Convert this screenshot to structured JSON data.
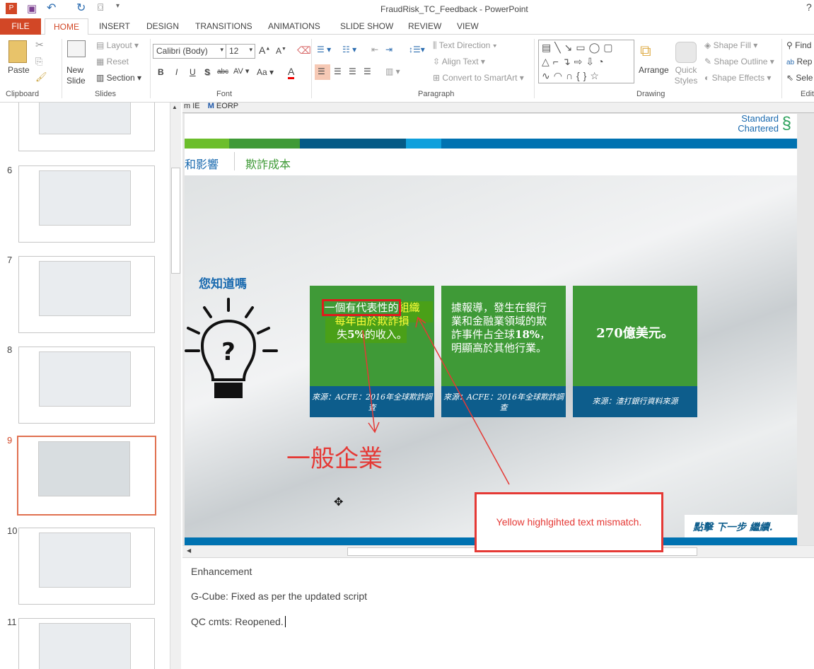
{
  "window": {
    "title": "FraudRisk_TC_Feedback - PowerPoint"
  },
  "tabs": {
    "file": "FILE",
    "items": [
      "HOME",
      "INSERT",
      "DESIGN",
      "TRANSITIONS",
      "ANIMATIONS",
      "SLIDE SHOW",
      "REVIEW",
      "VIEW"
    ]
  },
  "ribbon": {
    "clipboard": {
      "paste": "Paste",
      "label": "Clipboard"
    },
    "slides": {
      "new_slide": "New Slide",
      "layout": "Layout",
      "reset": "Reset",
      "section": "Section",
      "label": "Slides"
    },
    "font": {
      "family": "Calibri (Body)",
      "size": "12",
      "bold": "B",
      "italic": "I",
      "underline": "U",
      "shadow": "S",
      "strike": "abc",
      "spacing": "AV",
      "case": "Aa",
      "color": "A",
      "label": "Font"
    },
    "paragraph": {
      "text_direction": "Text Direction",
      "align_text": "Align Text",
      "smartart": "Convert to SmartArt",
      "label": "Paragraph"
    },
    "drawing": {
      "arrange": "Arrange",
      "quick_styles": "Quick Styles",
      "shape_fill": "Shape Fill",
      "shape_outline": "Shape Outline",
      "shape_effects": "Shape Effects",
      "label": "Drawing"
    },
    "editing": {
      "find": "Find",
      "replace": "Rep",
      "select": "Sele",
      "label": "Edit"
    }
  },
  "thumbnails": [
    {
      "num": "6"
    },
    {
      "num": "7"
    },
    {
      "num": "8"
    },
    {
      "num": "9",
      "selected": true
    },
    {
      "num": "10"
    },
    {
      "num": "11"
    }
  ],
  "slide": {
    "browser_bar": {
      "item1": "m IE",
      "item2_icon": "M",
      "item2": "EORP"
    },
    "logo": {
      "line1": "Standard",
      "line2": "Chartered"
    },
    "breadcrumb": {
      "prev": "和影響",
      "current": "欺詐成本"
    },
    "did_you_know": "您知道嗎",
    "cards": [
      {
        "text_plain": "一個有代表性的",
        "text_highlight1": "組織",
        "text_highlight2": "每年由於欺詐損",
        "text_end_a": "失",
        "text_bold": "5%",
        "text_end_b": "的收入。",
        "source": "來源：ACFE：2016年全球欺詐調查"
      },
      {
        "text_a": "據報導，發生在銀行業和金融業領域的欺詐事件占全球",
        "text_bold": "18%",
        "text_b": "，明顯高於其他行業。",
        "source": "來源：ACFE：2016年全球欺詐調查"
      },
      {
        "text": "270億美元。",
        "source": "來源：渣打銀行資料來源"
      }
    ],
    "annotation_red_text": "一般企業",
    "callout": "Yellow highlgihted text mismatch.",
    "next_prompt": "點擊 下一步 繼續."
  },
  "notes": {
    "lines": [
      "Enhancement",
      "G-Cube: Fixed as per the updated script",
      "QC cmts: Reopened."
    ]
  },
  "colors": {
    "file_tab": "#d24726",
    "slide_green": "#3f9a37",
    "slide_blue": "#0d5d8c",
    "annot_red": "#e53935"
  }
}
